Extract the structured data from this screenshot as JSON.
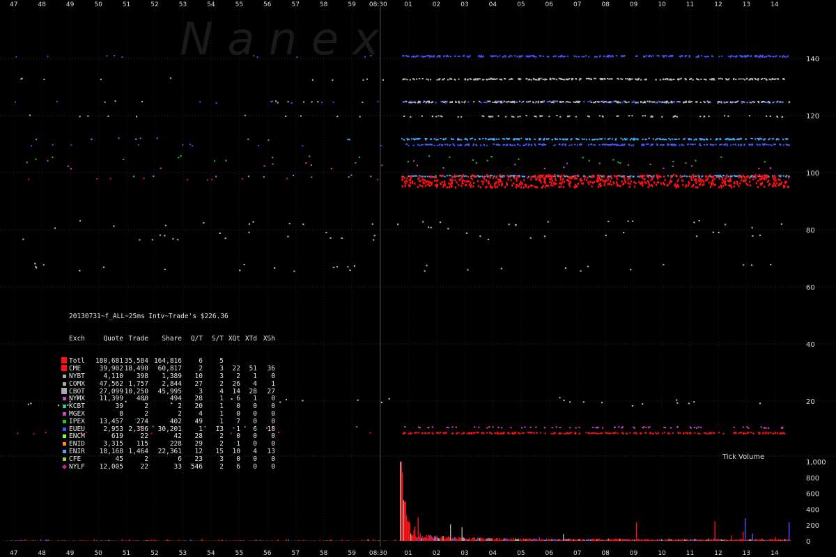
{
  "watermark": "N a n e x",
  "x_ticks": [
    "47",
    "48",
    "49",
    "50",
    "51",
    "52",
    "53",
    "54",
    "55",
    "56",
    "57",
    "58",
    "59",
    "08:30",
    "01",
    "02",
    "03",
    "04",
    "05",
    "06",
    "07",
    "08",
    "09",
    "10",
    "11",
    "12",
    "13",
    "14"
  ],
  "chart_data": [
    {
      "type": "scatter",
      "title": "",
      "xlabel": "",
      "ylabel": "",
      "yticks": [
        20,
        40,
        60,
        80,
        100,
        120,
        140
      ],
      "ylim": [
        5,
        155
      ],
      "grid": true,
      "levels": [
        {
          "y": 141,
          "color": "#4455ff",
          "density": "continuous-after-0830"
        },
        {
          "y": 133,
          "color": "#bbbbbb",
          "density": "continuous-after-0830"
        },
        {
          "y": 125,
          "color": "#bbbbbb",
          "density": "continuous-after-0830"
        },
        {
          "y": 125,
          "color": "#4455ff",
          "density": "partial"
        },
        {
          "y": 120,
          "color": "#bbbbbb",
          "density": "partial"
        },
        {
          "y": 112,
          "color": "#44aaff",
          "density": "continuous-after-0830"
        },
        {
          "y": 110,
          "color": "#4455ff",
          "density": "continuous-after-0830"
        },
        {
          "y": 105,
          "color": "#22cc22",
          "density": "sparse"
        },
        {
          "y": 103,
          "color": "#cc44cc",
          "density": "sparse"
        },
        {
          "y": 99,
          "color": "#44aaff",
          "density": "continuous-after-0830"
        },
        {
          "y": 98,
          "color": "#ff1111",
          "density": "dense-after-0830"
        },
        {
          "y": 82,
          "color": "#bbbbbb",
          "density": "sparse"
        },
        {
          "y": 78,
          "color": "#bbbbbb",
          "density": "sparse"
        },
        {
          "y": 67,
          "color": "#bbbbbb",
          "density": "sparse"
        },
        {
          "y": 20,
          "color": "#bbbbbb",
          "density": "sparse"
        },
        {
          "y": 11,
          "color": "#cc44cc",
          "density": "partial"
        },
        {
          "y": 9,
          "color": "#ff1111",
          "density": "continuous-after-0830"
        }
      ]
    },
    {
      "type": "bar",
      "title": "Tick Volume",
      "yticks": [
        0,
        200,
        400,
        600,
        800,
        "1,000"
      ],
      "ylim": [
        0,
        1000
      ],
      "peak": 980,
      "series": [
        {
          "color": "#ff1111"
        },
        {
          "color": "#aaaaaa"
        },
        {
          "color": "#4455ff"
        }
      ]
    }
  ],
  "stats": {
    "caption": "20130731~f_ALL~25ms Intv~Trade's $226.36",
    "headers": [
      "Exch",
      "Quote",
      "Trade",
      "Share",
      "Q/T",
      "S/T",
      "XQt",
      "XTd",
      "XSh"
    ],
    "rows": [
      {
        "color": "#ff1111",
        "cells": [
          "Totl",
          "180,681",
          "35,584",
          "164,816",
          "6",
          "5",
          "",
          "",
          ""
        ]
      },
      {
        "color": "#ff1111",
        "cells": [
          "CME",
          "39,902",
          "18,490",
          "60,817",
          "2",
          "3",
          "22",
          "51",
          "36"
        ]
      },
      {
        "color": "#aaaaaa",
        "cells": [
          "NYBT",
          "4,110",
          "398",
          "1,389",
          "10",
          "3",
          "2",
          "1",
          "0"
        ]
      },
      {
        "color": "#aaaaaa",
        "cells": [
          "COMX",
          "47,562",
          "1,757",
          "2,844",
          "27",
          "2",
          "26",
          "4",
          "1"
        ]
      },
      {
        "color": "#aaaaaa",
        "cells": [
          "CBOT",
          "27,099",
          "10,250",
          "45,995",
          "3",
          "4",
          "14",
          "28",
          "27"
        ]
      },
      {
        "color": "#cc44cc",
        "cells": [
          "NYMX",
          "11,399",
          "400",
          "494",
          "28",
          "1",
          "6",
          "1",
          "0"
        ]
      },
      {
        "color": "#22cc88",
        "cells": [
          "KCBT",
          "39",
          "2",
          "2",
          "20",
          "1",
          "0",
          "0",
          "0"
        ]
      },
      {
        "color": "#cc44cc",
        "cells": [
          "MGEX",
          "8",
          "2",
          "2",
          "4",
          "1",
          "0",
          "0",
          "0"
        ]
      },
      {
        "color": "#22cc22",
        "cells": [
          "IPEX",
          "13,457",
          "274",
          "402",
          "49",
          "1",
          "7",
          "0",
          "0"
        ]
      },
      {
        "color": "#4455ff",
        "cells": [
          "EUEU",
          "2,953",
          "2,386",
          "30,201",
          "1",
          "13",
          "1",
          "6",
          "18"
        ]
      },
      {
        "color": "#88ff22",
        "cells": [
          "ENCM",
          "619",
          "22",
          "42",
          "28",
          "2",
          "0",
          "0",
          "0"
        ]
      },
      {
        "color": "#ff8822",
        "cells": [
          "ENID",
          "3,315",
          "115",
          "228",
          "29",
          "2",
          "1",
          "0",
          "0"
        ]
      },
      {
        "color": "#44aaff",
        "cells": [
          "ENIR",
          "18,168",
          "1,464",
          "22,361",
          "12",
          "15",
          "10",
          "4",
          "13"
        ]
      },
      {
        "color": "#aacc22",
        "cells": [
          "CFE",
          "45",
          "2",
          "6",
          "23",
          "3",
          "0",
          "0",
          "0"
        ]
      },
      {
        "color": "#cc2288",
        "cells": [
          "NYLF",
          "12,005",
          "22",
          "33",
          "546",
          "2",
          "6",
          "0",
          "0"
        ]
      }
    ]
  }
}
